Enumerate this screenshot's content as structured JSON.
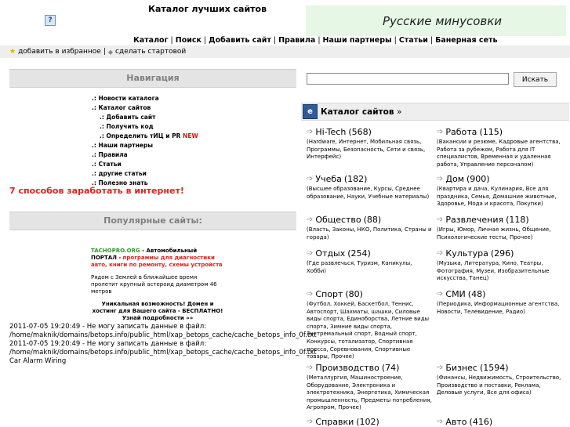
{
  "header": {
    "broken_image_glyph": "?",
    "title": "Каталог лучших сайтов",
    "banner_text": "Русские минусовки"
  },
  "topnav": {
    "items": [
      "Каталог",
      "Поиск",
      "Добавить сайт",
      "Правила",
      "Наши партнеры",
      "Статьи",
      "Банерная сеть"
    ],
    "separator": "|"
  },
  "topbar": {
    "bookmark": "добавить в избранное",
    "separator": "|",
    "homepage": "сделать стартовой"
  },
  "navigation": {
    "heading": "Навигация",
    "items": [
      {
        "prefix": ".:",
        "label": "Новости каталога"
      },
      {
        "prefix": ".:",
        "label": "Каталог сайтов"
      },
      {
        "prefix": ".:",
        "label": "Добавить сайт"
      },
      {
        "prefix": ".:",
        "label": "Получить код"
      },
      {
        "prefix": ".:",
        "label": "Определить тИЦ и PR",
        "badge": "NEW"
      },
      {
        "prefix": ".:",
        "label": "Наши партнеры"
      },
      {
        "prefix": ".:",
        "label": "Правила"
      },
      {
        "prefix": ".:",
        "label": "Статьи"
      },
      {
        "prefix": ".:",
        "label": "другие статьи"
      },
      {
        "prefix": ".:",
        "label": "Полезно знать"
      }
    ],
    "earn_link": "7 способов заработать в интернет!"
  },
  "popular": {
    "heading": "Популярные сайты:",
    "promo_brand": "TACHOPRO.ORG",
    "promo_title": " - Автомобильный ПОРТАЛ -",
    "promo_red": "программы для диагностики авто, книги по ремонту, схемы устройств",
    "asteroid": "Рядом с Землей в ближайшее время пролетит крупный астероид диаметром 46 метров",
    "domain_offer": "Уникальная возможность! Домен и хостинг для Вашего сайта - БЕСПЛАТНО! Узнай подробности »»"
  },
  "errors": [
    " 2011-07-05 19:20:49 - Не могу записать данные в файл:",
    "/home/maknik/domains/betops.info/public_html/xap_betops_cache/cache_betops_info_0f.txt",
    "2011-07-05 19:20:49 - Не могу записать данные в файл:",
    "/home/maknik/domains/betops.info/public_html/xap_betops_cache/cache_betops_info_0f.txt",
    "Car Alarm Wiring"
  ],
  "search": {
    "value": "",
    "button": "Искать"
  },
  "catalog": {
    "icon_glyph": "e",
    "title": "Каталог сайтов",
    "arrow": "»",
    "categories": [
      {
        "name": "Hi-Tech",
        "count": "(568)",
        "desc": "(Hardware, Интернет, Мобильная связь, Программы, Безопасность, Сети и связь, Интерфейс)"
      },
      {
        "name": "Работа",
        "count": "(115)",
        "desc": "(Вакансии и резюме, Кадровые агентства, Работа за рубежом, Работа для IT специалистов, Временная и удаленная работа, Управление персоналом)"
      },
      {
        "name": "Учеба",
        "count": "(182)",
        "desc": "(Высшее образование, Курсы, Среднее образование, Науки, Учебные материалы)"
      },
      {
        "name": "Дом",
        "count": "(900)",
        "desc": "(Квартира и дача, Кулинария, Все для праздника, Семья, Домашние животные, Здоровье, Мода и красота, Покупки)"
      },
      {
        "name": "Общество",
        "count": "(88)",
        "desc": "(Власть, Законы, НКО, Политика, Страны и города)"
      },
      {
        "name": "Развлечения",
        "count": "(118)",
        "desc": "(Игры, Юмор, Личная жизнь, Общение, Психологические тесты, Прочее)"
      },
      {
        "name": "Отдых",
        "count": "(254)",
        "desc": "(Где развлечься, Туризм, Каникулы, Хобби)"
      },
      {
        "name": "Культура",
        "count": "(296)",
        "desc": "(Музыка, Литература, Кино, Театры, Фотография, Музеи, Изобразительные искусства, Танец)"
      },
      {
        "name": "Спорт",
        "count": "(80)",
        "desc": "(Футбол, Хоккей, Баскетбол, Теннис, Автоспорт, Шахматы, шашки, Силовые виды спорта, Единоборства, Летние виды спорта, Зимние виды спорта, Экстремальный спорт, Водный спорт, Конкурсы, тотализатор, Спортивная пресса, Соревнования, Спортивные товары, Прочее)"
      },
      {
        "name": "СМИ",
        "count": "(48)",
        "desc": "(Периодика, Информационные агентства, Новости, Телевидение, Радио)"
      },
      {
        "name": "Производство",
        "count": "(74)",
        "desc": "(Металлургия, Машиностроение, Оборудование, Электроника и электротехника, Энергетика, Химическая промышленность, Предметы потребления, Агропром, Прочее)"
      },
      {
        "name": "Бизнес",
        "count": "(1594)",
        "desc": "(Финансы, Недвижимость, Строительство, Производство и поставки, Реклама, Деловые услуги, Все для офиса)"
      },
      {
        "name": "Справки",
        "count": "(102)",
        "desc": ""
      },
      {
        "name": "Авто",
        "count": "(416)",
        "desc": ""
      }
    ]
  }
}
